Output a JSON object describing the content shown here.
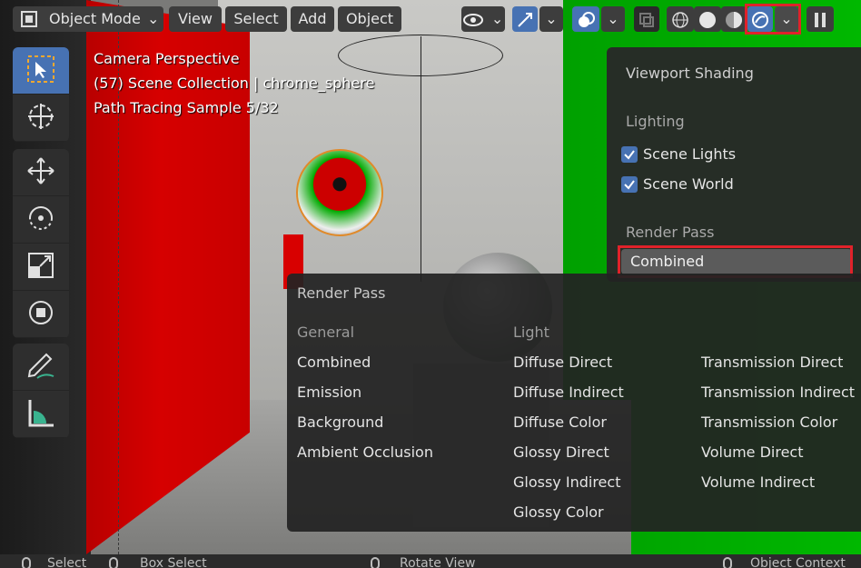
{
  "header": {
    "mode_label": "Object Mode",
    "menus": [
      "View",
      "Select",
      "Add",
      "Object"
    ]
  },
  "overlay": {
    "line1": "Camera Perspective",
    "line2": "(57) Scene Collection | chrome_sphere",
    "line3": "Path Tracing Sample 5/32"
  },
  "shading_popover": {
    "title": "Viewport Shading",
    "lighting_label": "Lighting",
    "scene_lights": "Scene Lights",
    "scene_world": "Scene World",
    "render_pass_label": "Render Pass",
    "render_pass_value": "Combined"
  },
  "render_pass_menu": {
    "title": "Render Pass",
    "general_header": "General",
    "light_header": "Light",
    "general_items": [
      "Combined",
      "Emission",
      "Background",
      "Ambient Occlusion"
    ],
    "light_items": [
      "Diffuse Direct",
      "Diffuse Indirect",
      "Diffuse Color",
      "Glossy Direct",
      "Glossy Indirect",
      "Glossy Color"
    ],
    "light_items_2": [
      "Transmission Direct",
      "Transmission Indirect",
      "Transmission Color",
      "Volume Direct",
      "Volume Indirect"
    ]
  },
  "statusbar": {
    "select": "Select",
    "box_select": "Box Select",
    "rotate_view": "Rotate View",
    "object_context": "Object Context"
  },
  "colors": {
    "accent": "#4772b3",
    "highlight_red": "#e0222a"
  }
}
